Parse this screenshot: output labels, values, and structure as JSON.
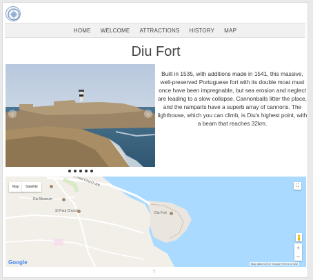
{
  "nav": {
    "items": [
      "HOME",
      "WELCOME",
      "ATTRACTIONS",
      "HISTORY",
      "MAP"
    ]
  },
  "page": {
    "title": "Diu Fort",
    "description": "Built in 1535, with additions made in 1541, this massive, well-preserved Portuguese fort with its double moat must once have been impregnable, but sea erosion and neglect are leading to a slow collapse. Cannonballs litter the place, and the ramparts have a superb array of cannons. The lighthouse, which you can climb, is Diu's highest point, with a beam that reaches 32km."
  },
  "carousel": {
    "prev_icon": "chevron-left-icon",
    "next_icon": "chevron-right-icon",
    "prev_glyph": "‹",
    "next_glyph": "›",
    "slide_count": 5,
    "active_index": 0
  },
  "map": {
    "type_map": "Map",
    "type_satellite": "Satellite",
    "labels": {
      "diu_museum": "Diu Museum",
      "st_paul_church": "St Paul Church",
      "diu_fort": "Diu Fort",
      "road_1": "St Paul Church Rd"
    },
    "zoom_in": "+",
    "zoom_out": "−",
    "fullscreen_glyph": "⛶",
    "google": "Google",
    "footer": "Map data ©2017 Google   Terms of Use"
  },
  "scroll_up_glyph": "↑",
  "colors": {
    "water": "#aadaff",
    "land": "#f2efe9",
    "nav_bg": "#f1f1f1"
  }
}
